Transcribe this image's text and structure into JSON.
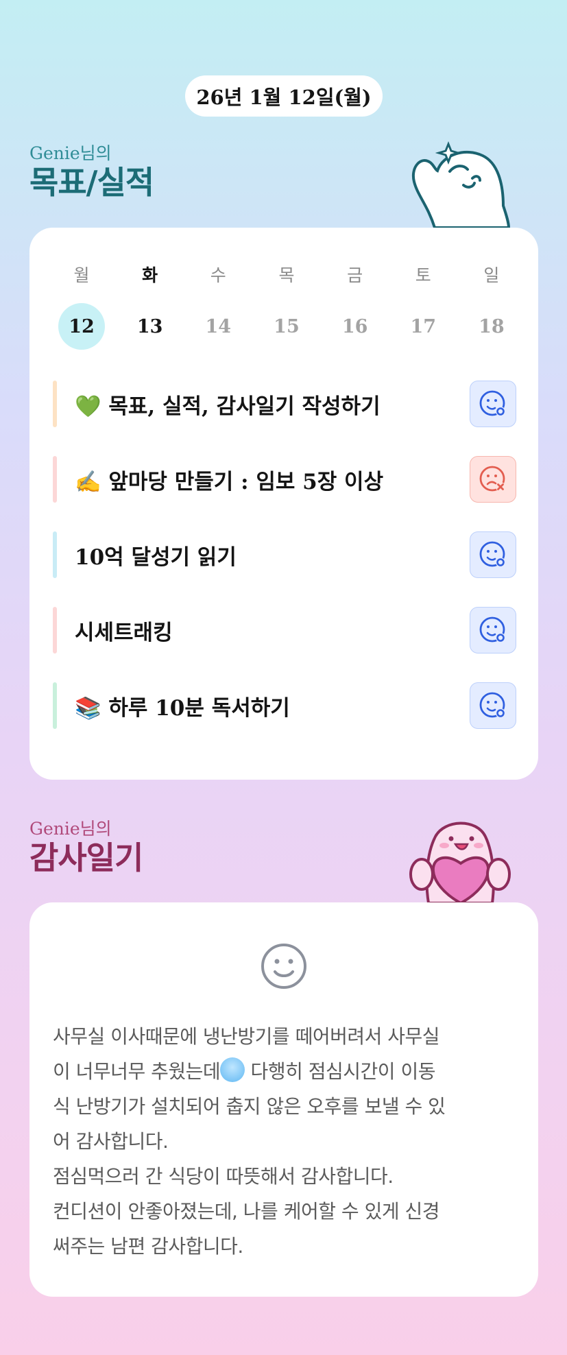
{
  "date_label": "26년 1월 12일(월)",
  "goals_section": {
    "owner_label": "Genie님의",
    "title": "목표/실적"
  },
  "calendar": {
    "weekdays": [
      "월",
      "화",
      "수",
      "목",
      "금",
      "토",
      "일"
    ],
    "days": [
      "12",
      "13",
      "14",
      "15",
      "16",
      "17",
      "18"
    ],
    "today_index": 0,
    "active_index": 1
  },
  "goals": [
    {
      "text": "💚 목표, 실적, 감사일기 작성하기",
      "status": "done-icon",
      "bar_color": "#fde2c4"
    },
    {
      "text": "✍️ 앞마당 만들기 : 임보 5장 이상",
      "status": "not-done-icon",
      "bar_color": "#fcd7d7"
    },
    {
      "text": "10억 달성기 읽기",
      "status": "done-icon",
      "bar_color": "#c9ecf6"
    },
    {
      "text": "시세트래킹",
      "status": "done-icon",
      "bar_color": "#fcd7d7"
    },
    {
      "text": "📚 하루 10분 독서하기",
      "status": "done-icon",
      "bar_color": "#c9f0dc"
    }
  ],
  "diary_section": {
    "owner_label": "Genie님의",
    "title": "감사일기"
  },
  "diary": {
    "mood_icon": "neutral-smile-icon",
    "lines": [
      "사무실 이사때문에 냉난방기를 떼어버려서 사무실",
      "이 너무너무 추웠는데",
      " 다행히 점심시간이 이동",
      "식 난방기가 설치되어 춥지 않은 오후를 보낼 수 있",
      "어 감사합니다.",
      "점심먹으러 간 식당이 따뜻해서 감사합니다.",
      "컨디션이 안좋아졌는데, 나를 케어할 수 있게 신경",
      "써주는 남편 감사합니다."
    ]
  }
}
